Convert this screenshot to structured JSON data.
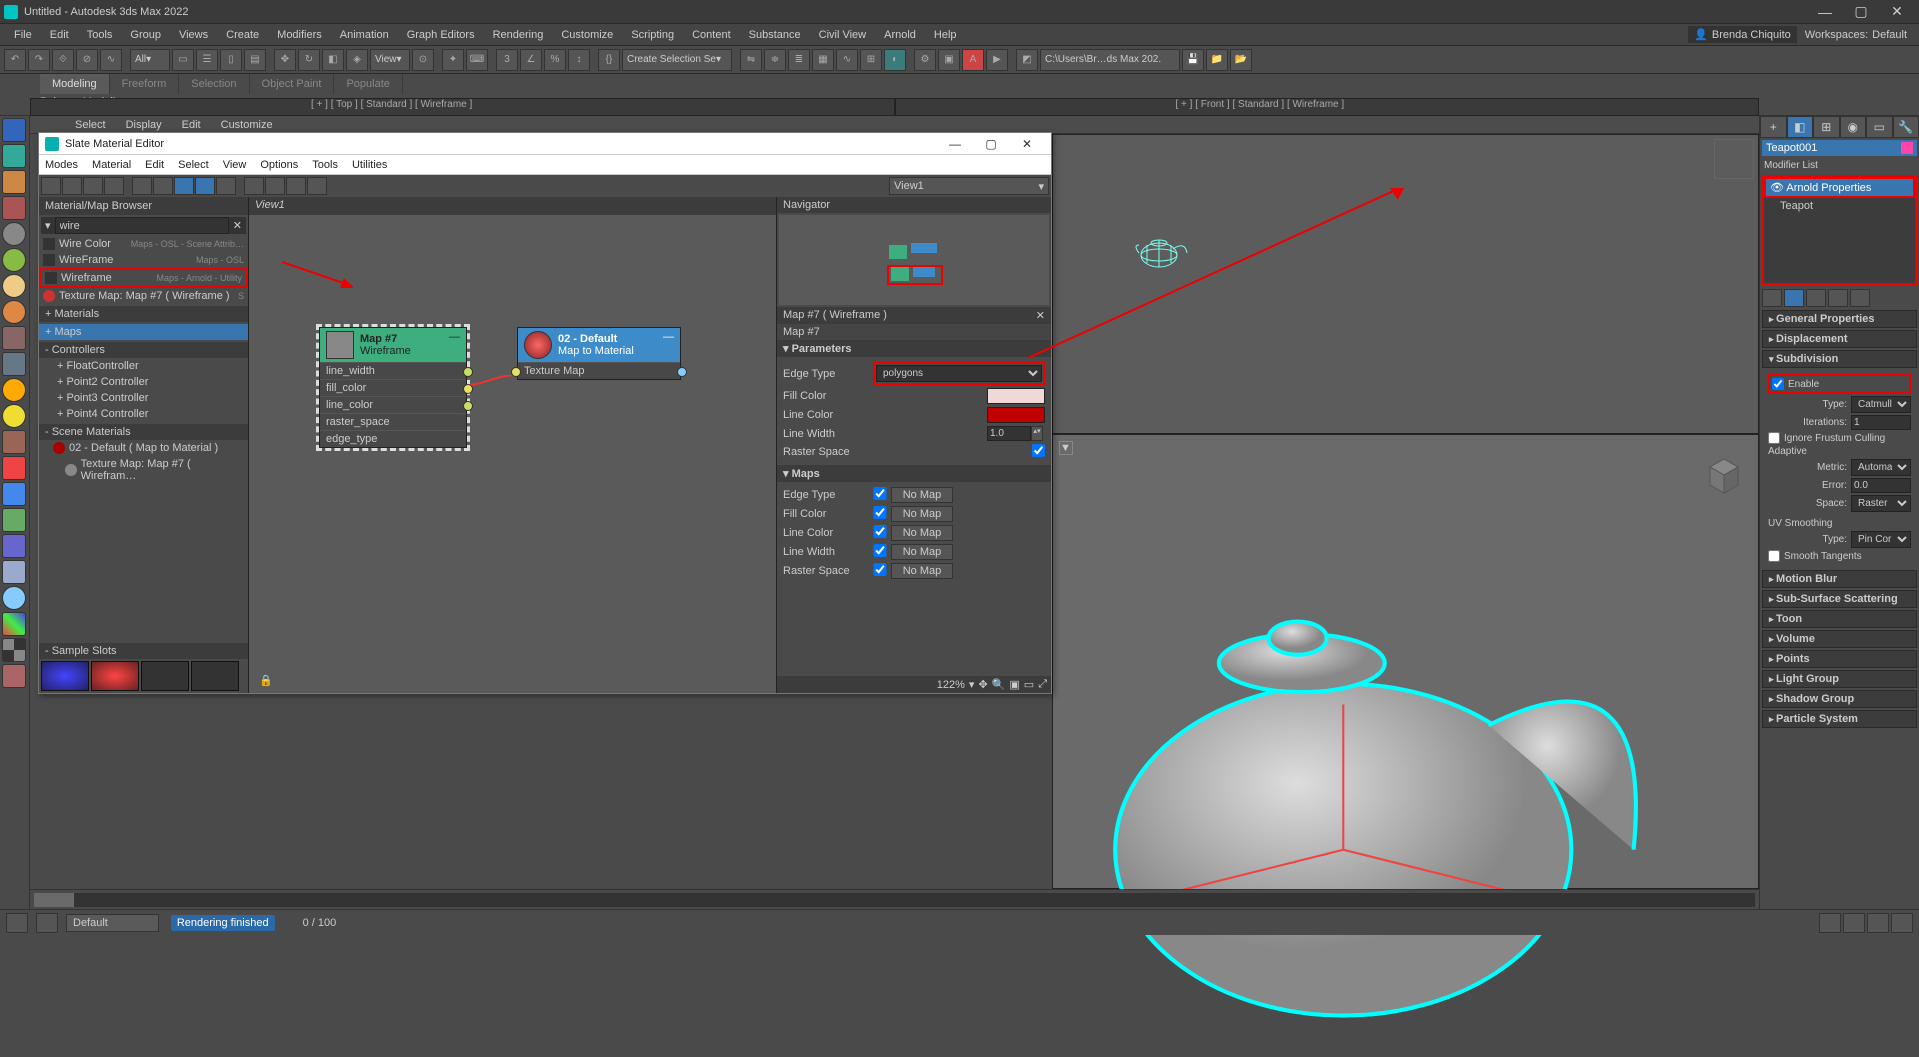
{
  "title": "Untitled - Autodesk 3ds Max 2022",
  "menu": [
    "File",
    "Edit",
    "Tools",
    "Group",
    "Views",
    "Create",
    "Modifiers",
    "Animation",
    "Graph Editors",
    "Rendering",
    "Customize",
    "Scripting",
    "Content",
    "Substance",
    "Civil View",
    "Arnold",
    "Help"
  ],
  "user": "Brenda Chiquito",
  "workspaces_label": "Workspaces:",
  "workspace": "Default",
  "toolbar": {
    "all": "All",
    "view": "View",
    "create_sel": "Create Selection Se",
    "path": "C:\\Users\\Br…ds Max 202."
  },
  "ribbon": {
    "tabs": [
      "Modeling",
      "Freeform",
      "Selection",
      "Object Paint",
      "Populate"
    ],
    "active": 0,
    "sub": "Polygon Modeling"
  },
  "subbar": [
    "Select",
    "Display",
    "Edit",
    "Customize"
  ],
  "vp": {
    "top": "[ + ] [ Top ] [ Standard ] [ Wireframe ]",
    "front": "[ + ] [ Front ] [ Standard ] [ Wireframe ]"
  },
  "slate": {
    "title": "Slate Material Editor",
    "menu": [
      "Modes",
      "Material",
      "Edit",
      "Select",
      "View",
      "Options",
      "Tools",
      "Utilities"
    ],
    "view_name": "View1",
    "browser_head": "Material/Map Browser",
    "search": "wire",
    "rows": [
      {
        "label": "Wire Color",
        "right": "Maps - OSL - Scene Attrib…"
      },
      {
        "label": "WireFrame",
        "right": "Maps - OSL"
      },
      {
        "label": "Wireframe",
        "right": "Maps - Arnold - Utility",
        "hl": true
      },
      {
        "label": "Texture Map: Map #7  ( Wireframe )",
        "right": "S"
      }
    ],
    "cats": [
      {
        "label": "+ Materials"
      },
      {
        "label": "+ Maps",
        "sel": true
      },
      {
        "label": "- Controllers",
        "subs": [
          "+ FloatController",
          "+ Point2 Controller",
          "+ Point3 Controller",
          "+ Point4 Controller"
        ]
      },
      {
        "label": "- Scene Materials",
        "tree": [
          {
            "label": "02 - Default  ( Map to Material )",
            "icon": "red"
          },
          {
            "label": "Texture Map: Map #7  ( Wirefram…",
            "indent": true
          }
        ]
      }
    ],
    "sample_head": "- Sample Slots",
    "graph_head": "View1",
    "node1": {
      "name": "Map #7",
      "type": "Wireframe",
      "rows": [
        "line_width",
        "fill_color",
        "line_color",
        "raster_space",
        "edge_type"
      ]
    },
    "node2": {
      "name": "02 - Default",
      "type": "Map to Material",
      "rows": [
        "Texture Map"
      ]
    },
    "nav_head": "Navigator",
    "param_title": "Map #7  ( Wireframe )",
    "param_name": "Map #7",
    "params_head": "Parameters",
    "maps_head": "Maps",
    "edge_type_label": "Edge Type",
    "edge_type_val": "polygons",
    "fill_color_label": "Fill Color",
    "fill_color_val": "#f0d8d8",
    "line_color_label": "Line Color",
    "line_color_val": "#c00000",
    "line_width_label": "Line Width",
    "line_width_val": "1.0",
    "raster_label": "Raster Space",
    "maps": [
      "Edge Type",
      "Fill Color",
      "Line Color",
      "Line Width",
      "Raster Space"
    ],
    "nomap": "No Map",
    "zoom": "122%"
  },
  "cmd": {
    "name": "Teapot001",
    "modlabel": "Modifier List",
    "mods": [
      "Arnold Properties",
      "Teapot"
    ],
    "gen": "General Properties",
    "disp": "Displacement",
    "subdiv": "Subdivision",
    "enable": "Enable",
    "type_l": "Type:",
    "type_v": "Catmull-Clark",
    "iter_l": "Iterations:",
    "iter_v": "1",
    "frustum": "Ignore Frustum Culling",
    "adaptive": "Adaptive",
    "metric_l": "Metric:",
    "metric_v": "Automatic",
    "error_l": "Error:",
    "error_v": "0.0",
    "space_l": "Space:",
    "space_v": "Raster",
    "uv_head": "UV Smoothing",
    "uvtype_l": "Type:",
    "uvtype_v": "Pin Corners",
    "smooth_t": "Smooth Tangents",
    "rolls": [
      "Motion Blur",
      "Sub-Surface Scattering",
      "Toon",
      "Volume",
      "Points",
      "Light Group",
      "Shadow Group",
      "Particle System"
    ]
  },
  "status": {
    "default": "Default",
    "render": "Rendering finished",
    "frame": "0 / 100"
  }
}
